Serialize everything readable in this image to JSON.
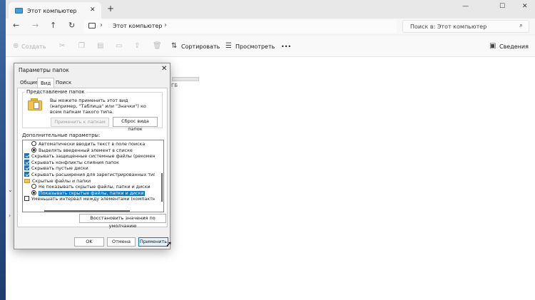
{
  "explorer": {
    "tab_title": "Этот компьютер",
    "tab_close": "✕",
    "new_tab": "+",
    "win_min": "—",
    "win_max": "☐",
    "win_close": "✕",
    "nav_back": "←",
    "nav_forward": "→",
    "nav_up": "↑",
    "nav_refresh": "↻",
    "address_text": "Этот компьютер",
    "address_chevron": "›",
    "address_chevron2": "›",
    "search_placeholder": "Поиск в: Этот компьютер",
    "search_icon": "⌕",
    "cmd_create": "Создать",
    "cmd_sort": "Сортировать",
    "cmd_view": "Просмотреть",
    "cmd_more": "•••",
    "cmd_details": "Сведения",
    "partial_size": "ГБ"
  },
  "dialog": {
    "title": "Параметры папок",
    "close": "✕",
    "tabs": [
      "Общие",
      "Вид",
      "Поиск"
    ],
    "group_title": "Представление папок",
    "group_desc": "Вы можете применить этот вид (например, \"Таблица\" или \"Значки\") ко всем папкам такого типа.",
    "apply_to_folders": "Применить к папкам",
    "reset_folders": "Сброс вида папок",
    "advanced_label": "Дополнительные параметры:",
    "tree_rows": [
      {
        "kind": "radio",
        "state": "off",
        "text": "Автоматически вводить текст в поле поиска",
        "indent": 2
      },
      {
        "kind": "radio",
        "state": "on",
        "text": "Выделять введенный элемент в списке",
        "indent": 2
      },
      {
        "kind": "check",
        "state": "on",
        "text": "Скрывать защищенные системные файлы (рекомен",
        "indent": 0
      },
      {
        "kind": "check",
        "state": "on",
        "text": "Скрывать конфликты слияния папок",
        "indent": 0
      },
      {
        "kind": "check",
        "state": "on",
        "text": "Скрывать пустые диски",
        "indent": 0
      },
      {
        "kind": "check",
        "state": "on",
        "text": "Скрывать расширения для зарегистрированных типо",
        "indent": 0
      },
      {
        "kind": "folder",
        "state": "",
        "text": "Скрытые файлы и папки",
        "indent": 0
      },
      {
        "kind": "radio",
        "state": "off",
        "text": "Не показывать скрытые файлы, папки и диски",
        "indent": 2
      },
      {
        "kind": "radio",
        "state": "on",
        "text": "Показывать скрытые файлы, папки и диски",
        "indent": 2,
        "selected": true
      },
      {
        "kind": "check",
        "state": "off",
        "text": "Уменьшать интервал между элементами (компактн",
        "indent": 0
      }
    ],
    "restore_defaults": "Восстановить значения по умолчанию",
    "ok": "OK",
    "cancel": "Отмена",
    "apply": "Применить"
  }
}
